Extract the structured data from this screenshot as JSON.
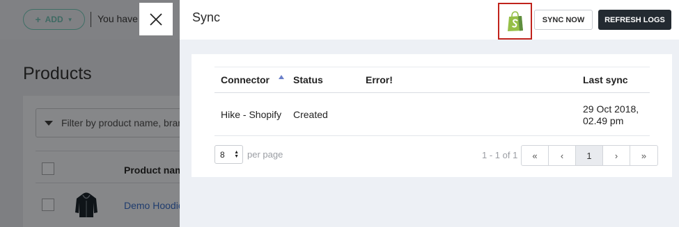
{
  "background": {
    "add_button": {
      "label": "ADD"
    },
    "notice": "You have",
    "title": "Products",
    "filter_placeholder": "Filter by product name, bran",
    "table": {
      "column_header": "Product nam",
      "row_product": "Demo Hoodie"
    }
  },
  "panel": {
    "title": "Sync",
    "sync_now_label": "SYNC NOW",
    "refresh_logs_label": "REFRESH LOGS",
    "table": {
      "headers": {
        "connector": "Connector",
        "status": "Status",
        "error": "Error!",
        "last_sync": "Last sync"
      },
      "rows": [
        {
          "connector": "Hike - Shopify",
          "status": "Created",
          "error": "",
          "last_sync_date": "29 Oct 2018,",
          "last_sync_time": "02.49 pm"
        }
      ]
    },
    "pagination": {
      "per_page_value": "8",
      "per_page_label": "per page",
      "range": "1 - 1 of 1",
      "first": "«",
      "prev": "‹",
      "current": "1",
      "next": "›",
      "last": "»"
    }
  },
  "colors": {
    "accent_dark": "#232a31",
    "highlight_border": "#c0231c",
    "shopify_green": "#95bf47"
  },
  "icons": {
    "close": "close-icon",
    "shopify": "shopify-bag-icon",
    "sort": "sort-asc-icon",
    "filter": "filter-icon"
  }
}
